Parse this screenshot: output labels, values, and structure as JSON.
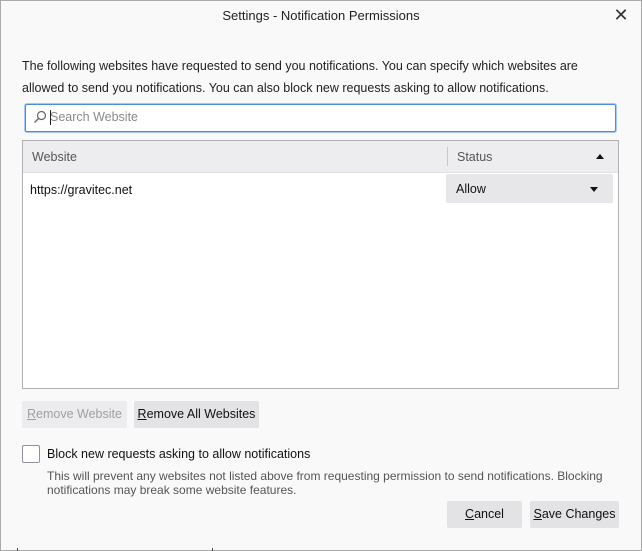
{
  "window": {
    "title": "Settings - Notification Permissions",
    "close_glyph": "✕"
  },
  "description": "The following websites have requested to send you notifications. You can specify which websites are allowed to send you notifications. You can also block new requests asking to allow notifications.",
  "search": {
    "placeholder": "Search Website",
    "icon": "search-icon"
  },
  "table": {
    "columns": [
      "Website",
      "Status"
    ],
    "sort_column": "Status",
    "sort_direction": "ascending",
    "rows": [
      {
        "website": "https://gravitec.net",
        "status": "Allow"
      }
    ]
  },
  "buttons": {
    "remove_website": {
      "prefix": "",
      "mnemonic": "R",
      "rest": "emove Website",
      "enabled": false
    },
    "remove_all": {
      "prefix": "",
      "mnemonic": "R",
      "rest": "emove All Websites",
      "enabled": true
    },
    "cancel": {
      "prefix": "",
      "mnemonic": "C",
      "rest": "ancel"
    },
    "save": {
      "prefix": "",
      "mnemonic": "S",
      "rest": "ave Changes"
    }
  },
  "block_requests": {
    "label": "Block new requests asking to allow notifications",
    "checked": false,
    "note": "This will prevent any websites not listed above from requesting permission to send notifications. Blocking notifications may break some website features."
  },
  "colors": {
    "focus_border": "#4a90d9",
    "button_bg": "#e3e3e5"
  }
}
